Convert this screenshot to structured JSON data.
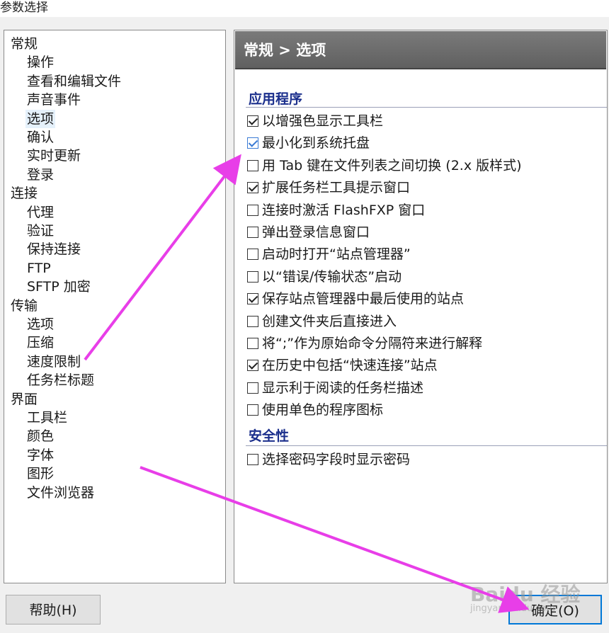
{
  "window": {
    "title": "参数选择"
  },
  "tree": [
    {
      "label": "常规",
      "level": 0
    },
    {
      "label": "操作",
      "level": 1
    },
    {
      "label": "查看和编辑文件",
      "level": 1
    },
    {
      "label": "声音事件",
      "level": 1
    },
    {
      "label": "选项",
      "level": 1,
      "selected": true
    },
    {
      "label": "确认",
      "level": 1
    },
    {
      "label": "实时更新",
      "level": 1
    },
    {
      "label": "登录",
      "level": 1
    },
    {
      "label": "连接",
      "level": 0
    },
    {
      "label": "代理",
      "level": 1
    },
    {
      "label": "验证",
      "level": 1
    },
    {
      "label": "保持连接",
      "level": 1
    },
    {
      "label": "FTP",
      "level": 1
    },
    {
      "label": "SFTP 加密",
      "level": 1
    },
    {
      "label": "传输",
      "level": 0
    },
    {
      "label": "选项",
      "level": 1
    },
    {
      "label": "压缩",
      "level": 1
    },
    {
      "label": "速度限制",
      "level": 1
    },
    {
      "label": "任务栏标题",
      "level": 1
    },
    {
      "label": "界面",
      "level": 0
    },
    {
      "label": "工具栏",
      "level": 1
    },
    {
      "label": "颜色",
      "level": 1
    },
    {
      "label": "字体",
      "level": 1
    },
    {
      "label": "图形",
      "level": 1
    },
    {
      "label": "文件浏览器",
      "level": 1
    }
  ],
  "panel": {
    "header": "常规 > 选项",
    "sections": [
      {
        "title": "应用程序",
        "options": [
          {
            "label": "以增强色显示工具栏",
            "checked": true
          },
          {
            "label": "最小化到系统托盘",
            "checked": true,
            "focused": true
          },
          {
            "label": "用 Tab 键在文件列表之间切换 (2.x 版样式)",
            "checked": false
          },
          {
            "label": "扩展任务栏工具提示窗口",
            "checked": true
          },
          {
            "label": "连接时激活 FlashFXP 窗口",
            "checked": false
          },
          {
            "label": "弹出登录信息窗口",
            "checked": false
          },
          {
            "label": "启动时打开“站点管理器”",
            "checked": false
          },
          {
            "label": "以“错误/传输状态”启动",
            "checked": false
          },
          {
            "label": "保存站点管理器中最后使用的站点",
            "checked": true
          },
          {
            "label": "创建文件夹后直接进入",
            "checked": false
          },
          {
            "label": "将“;”作为原始命令分隔符来进行解释",
            "checked": false
          },
          {
            "label": "在历史中包括“快速连接”站点",
            "checked": true
          },
          {
            "label": "显示利于阅读的任务栏描述",
            "checked": false
          },
          {
            "label": "使用单色的程序图标",
            "checked": false
          }
        ]
      },
      {
        "title": "安全性",
        "options": [
          {
            "label": "选择密码字段时显示密码",
            "checked": false
          }
        ]
      }
    ]
  },
  "buttons": {
    "help": "帮助(H)",
    "ok": "确定(O)"
  },
  "watermark": {
    "brand": "Baidu 经验",
    "url": "jingyan.baidu.com"
  },
  "colors": {
    "arrow": "#e83ee8",
    "section_title": "#1b2f8c",
    "header_bg": "#6b6b6b",
    "selected_bg": "#e5f1fb"
  }
}
